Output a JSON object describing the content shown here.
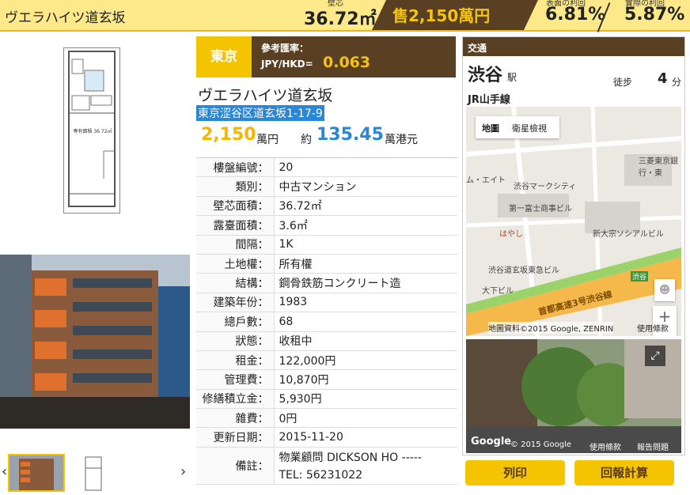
{
  "header": {
    "title": "ヴエラハイツ道玄坂",
    "area_label": "壁芯",
    "area_value": "36.72㎡",
    "price": "售2,150萬円",
    "gross_yield_label": "表面の利回",
    "gross_yield": "6.81%",
    "net_yield_label": "實際の利回",
    "net_yield": "5.87%"
  },
  "left": {
    "floorplan_label": "専有面積 36.72㎡",
    "thumb_prev": "‹",
    "thumb_next": "›"
  },
  "info": {
    "location": "東京",
    "rate_label": "參考匯率：",
    "rate_currency": "JPY/HKD=",
    "rate_value": "0.063",
    "name": "ヴエラハイツ道玄坂",
    "address": "東京涩谷区道玄坂1-17-9",
    "price_jpy": "2,150",
    "price_jpy_unit": "萬円",
    "price_approx": "約",
    "price_hkd": "135.45",
    "price_hkd_unit": "萬港元",
    "specs": [
      {
        "k": "樓盤編號：",
        "v": "20"
      },
      {
        "k": "類別：",
        "v": "中古マンション"
      },
      {
        "k": "壁芯面積：",
        "v": "36.72㎡"
      },
      {
        "k": "露臺面積：",
        "v": "3.6㎡"
      },
      {
        "k": "間隔：",
        "v": "1K"
      },
      {
        "k": "土地權：",
        "v": "所有權"
      },
      {
        "k": "結構：",
        "v": "鋼骨鉄筋コンクリート造"
      },
      {
        "k": "建築年份：",
        "v": "1983"
      },
      {
        "k": "總戶數：",
        "v": "68"
      },
      {
        "k": "狀態：",
        "v": "收租中"
      },
      {
        "k": "租金：",
        "v": "122,000円"
      },
      {
        "k": "管理費：",
        "v": "10,870円"
      },
      {
        "k": "修繕積立金：",
        "v": "5,930円"
      },
      {
        "k": "雜費：",
        "v": "0円"
      },
      {
        "k": "更新日期：",
        "v": "2015-11-20"
      }
    ],
    "remark_key": "備註：",
    "remark_line1": "物業顧問 DICKSON HO -----",
    "remark_line2": "TEL: 56231022"
  },
  "transport": {
    "header": "交通",
    "station": "渋谷",
    "station_suffix": "駅",
    "walk_label": "徒步",
    "walk_minutes": "4",
    "walk_unit": "分",
    "line": "JR山手線",
    "map_tab_map": "地圖",
    "map_tab_satellite": "衛星檢視",
    "map_copyright": "地圖資料©2015 Google, ZENRIN",
    "map_terms": "使用條款",
    "zoom_in": "+",
    "zoom_out": "−",
    "map_labels": [
      "渋谷マークシティ",
      "第一富士商事ビル",
      "新大宗ソシアルビル",
      "渋谷道玄坂東急ビル",
      "大下ビル",
      "首都高速3号渋谷線",
      "三菱東京銀行・東",
      "ム・エイト",
      "はやし",
      "渋谷"
    ],
    "street_copyright": "© 2015 Google",
    "street_terms": "使用條款",
    "street_report": "報告問題",
    "street_google": "Google"
  },
  "buttons": {
    "print": "列印",
    "calc": "回報計算"
  },
  "colors": {
    "header_bg": "#fde98a",
    "brown": "#5a4023",
    "gold": "#f5c400",
    "blue": "#2a86d6"
  }
}
